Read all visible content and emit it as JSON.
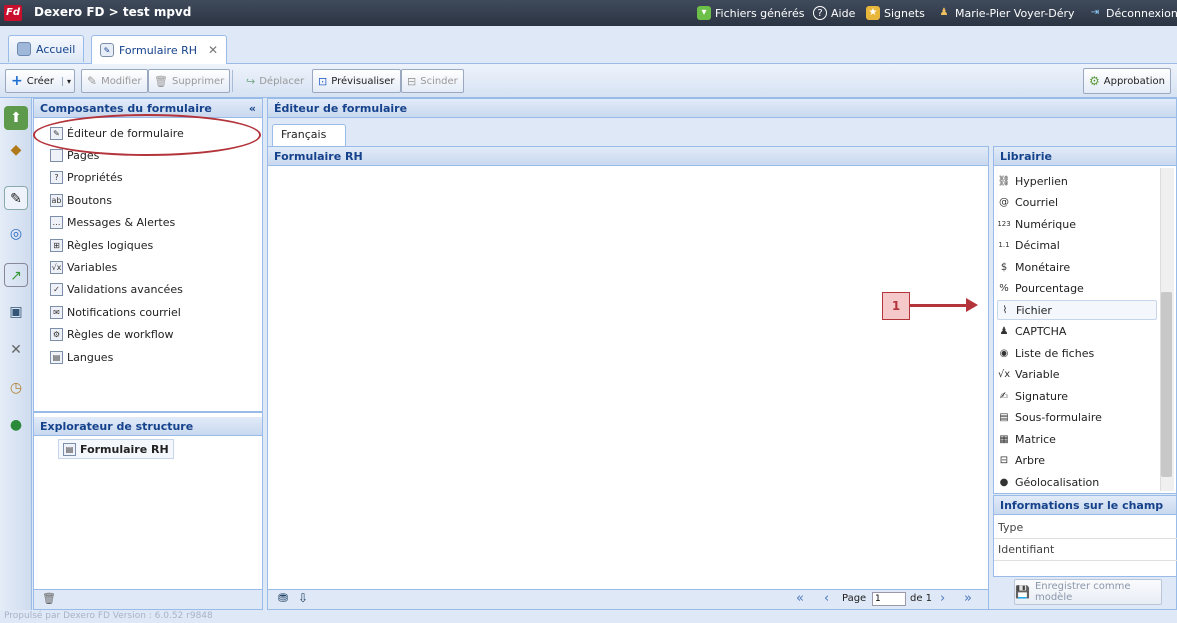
{
  "app": {
    "title": "Dexero FD > test mpvd",
    "logo_text": "Fd",
    "top_links": [
      {
        "label": "Fichiers générés",
        "icon": "files-icon"
      },
      {
        "label": "Aide",
        "icon": "help-icon"
      },
      {
        "label": "Signets",
        "icon": "bookmark-star-icon"
      },
      {
        "label": "Marie-Pier Voyer-Déry",
        "icon": "user-icon"
      },
      {
        "label": "Déconnexion",
        "icon": "logout-icon"
      }
    ]
  },
  "tabs": [
    {
      "label": "Accueil",
      "active": false
    },
    {
      "label": "Formulaire RH",
      "active": true,
      "close": "✕"
    }
  ],
  "toolbar": {
    "create": "Créer",
    "modify": "Modifier",
    "delete": "Supprimer",
    "move": "Déplacer",
    "preview": "Prévisualiser",
    "split": "Scinder",
    "approval": "Approbation"
  },
  "components_panel": {
    "title": "Composantes du formulaire",
    "collapse": "«",
    "items": [
      {
        "label": "Éditeur de formulaire",
        "icon": "form-editor-icon",
        "glyph": "✎"
      },
      {
        "label": "Pages",
        "icon": "page-icon",
        "glyph": ""
      },
      {
        "label": "Propriétés",
        "icon": "properties-icon",
        "glyph": "?"
      },
      {
        "label": "Boutons",
        "icon": "button-icon",
        "glyph": "ab"
      },
      {
        "label": "Messages & Alertes",
        "icon": "message-icon",
        "glyph": "…"
      },
      {
        "label": "Règles logiques",
        "icon": "logic-rules-icon",
        "glyph": "⊞"
      },
      {
        "label": "Variables",
        "icon": "sqrt-x-icon",
        "glyph": "√x"
      },
      {
        "label": "Validations avancées",
        "icon": "validation-icon",
        "glyph": "✓"
      },
      {
        "label": "Notifications courriel",
        "icon": "mail-icon",
        "glyph": "✉"
      },
      {
        "label": "Règles de workflow",
        "icon": "workflow-icon",
        "glyph": "⚙"
      },
      {
        "label": "Langues",
        "icon": "language-icon",
        "glyph": "▤"
      }
    ]
  },
  "structure_panel": {
    "title": "Explorateur de structure",
    "root": "Formulaire RH"
  },
  "editor": {
    "title": "Éditeur de formulaire",
    "lang_tab": "Français",
    "form_title": "Formulaire RH",
    "pager": {
      "page_label": "Page",
      "page_value": "1",
      "of_label": "de 1"
    }
  },
  "library": {
    "title": "Librairie",
    "items": [
      {
        "label": "Hyperlien",
        "icon": "hyperlink-icon",
        "glyph": "⛓"
      },
      {
        "label": "Courriel",
        "icon": "at-icon",
        "glyph": "@"
      },
      {
        "label": "Numérique",
        "icon": "numeric-icon",
        "glyph": "123"
      },
      {
        "label": "Décimal",
        "icon": "decimal-icon",
        "glyph": "1.1"
      },
      {
        "label": "Monétaire",
        "icon": "currency-icon",
        "glyph": "$"
      },
      {
        "label": "Pourcentage",
        "icon": "percent-icon",
        "glyph": "%"
      },
      {
        "label": "Fichier",
        "icon": "paperclip-icon",
        "glyph": "⌇"
      },
      {
        "label": "CAPTCHA",
        "icon": "captcha-user-icon",
        "glyph": "♟"
      },
      {
        "label": "Liste de fiches",
        "icon": "list-cards-icon",
        "glyph": "◉"
      },
      {
        "label": "Variable",
        "icon": "sqrt-x-icon",
        "glyph": "√x"
      },
      {
        "label": "Signature",
        "icon": "signature-icon",
        "glyph": "✍"
      },
      {
        "label": "Sous-formulaire",
        "icon": "subform-icon",
        "glyph": "▤"
      },
      {
        "label": "Matrice",
        "icon": "matrix-icon",
        "glyph": "▦"
      },
      {
        "label": "Arbre",
        "icon": "tree-icon",
        "glyph": "⊟"
      },
      {
        "label": "Géolocalisation",
        "icon": "globe-pin-icon",
        "glyph": "●"
      }
    ]
  },
  "field_info": {
    "title": "Informations sur le champ",
    "rows": [
      "Type",
      "Identifiant"
    ],
    "save_template": "Enregistrer comme modèle"
  },
  "annotation": {
    "callout": "1"
  },
  "status_text": "Propulsé par Dexero FD Version : 6.0.52 r9848"
}
